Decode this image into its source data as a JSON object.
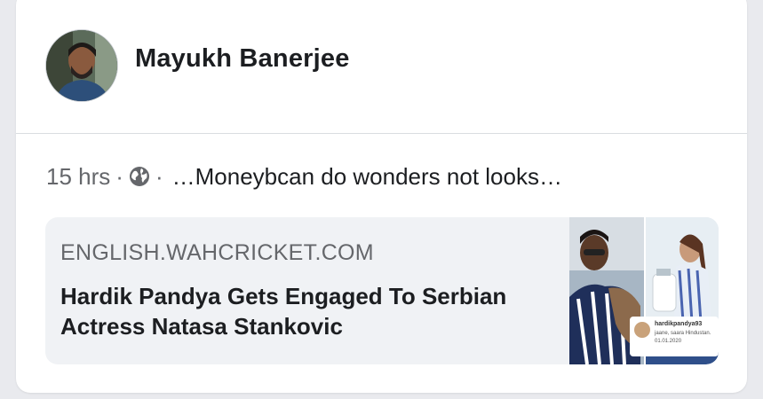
{
  "post": {
    "author": "Mayukh Banerjee",
    "time": "15 hrs",
    "separator": "·",
    "privacy_icon": "globe-icon",
    "caption": "…Moneybcan do wonders not looks…"
  },
  "link_preview": {
    "domain": "ENGLISH.WAHCRICKET.COM",
    "headline": "Hardik Pandya Gets Engaged To Serbian Actress Natasa Stankovic",
    "thumbnail": {
      "insta_user": "hardikpandya93",
      "insta_line1": "jaane, saara Hindustan.",
      "insta_line2": "01.01.2020"
    }
  },
  "colors": {
    "card_bg": "#ffffff",
    "page_bg": "#e9eaee",
    "text_primary": "#1c1e21",
    "text_secondary": "#65676b",
    "link_bg": "#f0f2f5"
  }
}
